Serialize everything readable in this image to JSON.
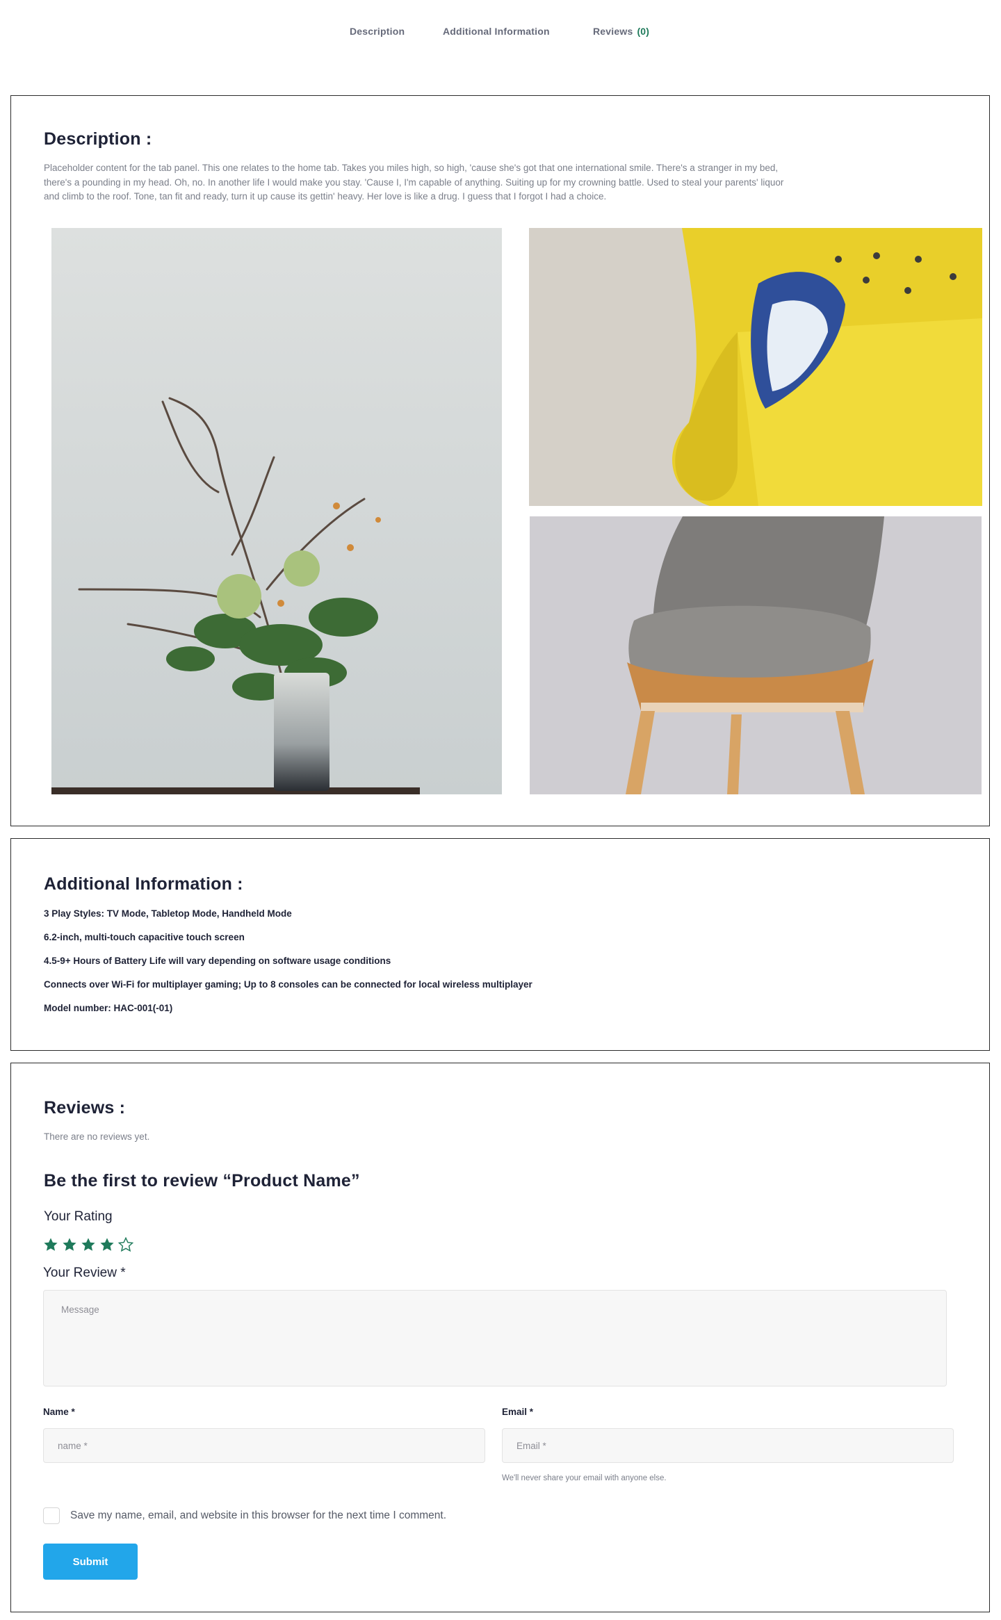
{
  "tabs": [
    {
      "label": "Description"
    },
    {
      "label": "Additional Information"
    },
    {
      "label": "Reviews",
      "count": "(0)"
    }
  ],
  "description": {
    "heading": "Description :",
    "text": "Placeholder content for the tab panel. This one relates to the home tab. Takes you miles high, so high, 'cause she's got that one international smile. There's a stranger in my bed, there's a pounding in my head. Oh, no. In another life I would make you stay. 'Cause I, I'm capable of anything. Suiting up for my crowning battle. Used to steal your parents' liquor and climb to the roof. Tone, tan fit and ready, turn it up cause its gettin' heavy. Her love is like a drug. I guess that I forgot I had a choice.",
    "images": [
      {
        "name": "vase-with-flowers-photo",
        "icon": "vase-flowers"
      },
      {
        "name": "yellow-sofa-photo",
        "icon": "yellow-sofa"
      },
      {
        "name": "grey-chair-photo",
        "icon": "grey-chair"
      }
    ]
  },
  "additional_info": {
    "heading": "Additional Information :",
    "lines": [
      "3 Play Styles: TV Mode, Tabletop Mode, Handheld Mode",
      "6.2-inch, multi-touch capacitive touch screen",
      "4.5-9+ Hours of Battery Life will vary depending on software usage conditions",
      "Connects over Wi-Fi for multiplayer gaming; Up to 8 consoles can be connected for local wireless multiplayer",
      "Model number: HAC-001(-01)"
    ]
  },
  "reviews": {
    "heading": "Reviews :",
    "empty_text": "There are no reviews yet.",
    "form_title": "Be the first to review “Product Name”",
    "rating_label": "Your Rating",
    "rating": 4,
    "rating_max": 5,
    "review_label": "Your Review *",
    "message_placeholder": "Message",
    "name_label": "Name *",
    "name_placeholder": "name *",
    "email_label": "Email *",
    "email_placeholder": "Email *",
    "email_help": "We'll never share your email with anyone else.",
    "save_checkbox_label": "Save my name, email, and website in this browser for the next time I comment.",
    "submit_label": "Submit"
  },
  "colors": {
    "accent_green": "#1f7a5b",
    "button_blue": "#22a6ea",
    "heading": "#1e2236"
  }
}
